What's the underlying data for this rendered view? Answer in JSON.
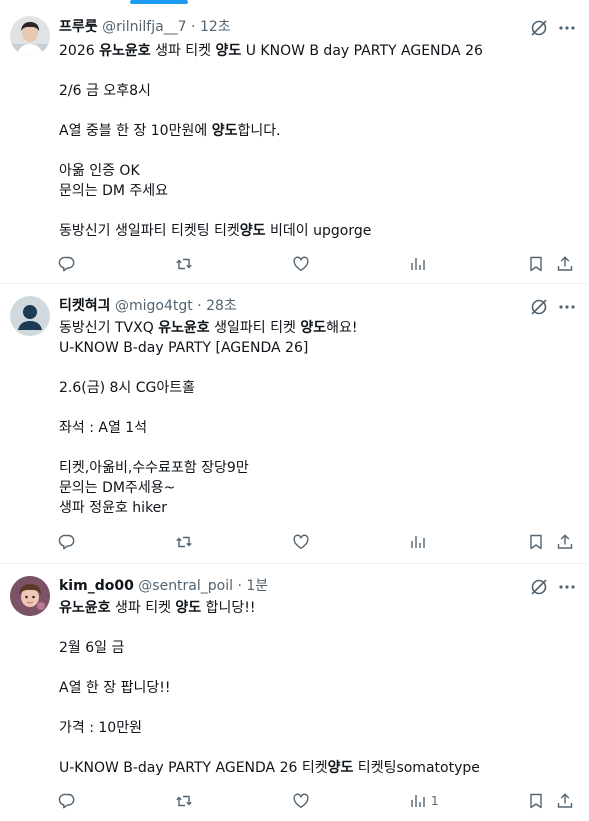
{
  "tweets": [
    {
      "name": "프루룻",
      "handle": "@rilnilfja__7",
      "time": "12초",
      "lines": [
        [
          {
            "t": "2026 "
          },
          {
            "t": "유노윤호",
            "b": true
          },
          {
            "t": " 생파 티켓 "
          },
          {
            "t": "양도",
            "b": true
          },
          {
            "t": " U KNOW B day PARTY AGENDA 26"
          }
        ],
        [],
        [
          {
            "t": "2/6 금 오후8시"
          }
        ],
        [],
        [
          {
            "t": "A열 중블 한 장 10만원에 "
          },
          {
            "t": "양도",
            "b": true
          },
          {
            "t": "합니다."
          }
        ],
        [],
        [
          {
            "t": "아옮 인증 OK"
          }
        ],
        [
          {
            "t": "문의는 DM 주세요"
          }
        ],
        [],
        [
          {
            "t": "동방신기 생일파티 티켓팅 티켓"
          },
          {
            "t": "양도",
            "b": true
          },
          {
            "t": " 비데이 upgorge"
          }
        ]
      ],
      "views": ""
    },
    {
      "name": "티켓혀긔",
      "handle": "@migo4tgt",
      "time": "28초",
      "lines": [
        [
          {
            "t": "동방신기 TVXQ "
          },
          {
            "t": "유노윤호",
            "b": true
          },
          {
            "t": " 생일파티 티켓 "
          },
          {
            "t": "양도",
            "b": true
          },
          {
            "t": "해요!"
          }
        ],
        [
          {
            "t": "U-KNOW B-day PARTY [AGENDA 26]"
          }
        ],
        [],
        [
          {
            "t": "2.6(금) 8시 CG아트홀"
          }
        ],
        [],
        [
          {
            "t": "좌석 : A열 1석"
          }
        ],
        [],
        [
          {
            "t": "티켓,아옮비,수수료포함 장당9만"
          }
        ],
        [
          {
            "t": "문의는 DM주세용~"
          }
        ],
        [
          {
            "t": "생파 정윤호 hiker"
          }
        ]
      ],
      "views": ""
    },
    {
      "name": "kim_do00",
      "handle": "@sentral_poil",
      "time": "1분",
      "lines": [
        [
          {
            "t": "유노윤호",
            "b": true
          },
          {
            "t": " 생파 티켓 "
          },
          {
            "t": "양도",
            "b": true
          },
          {
            "t": " 합니당!!"
          }
        ],
        [],
        [
          {
            "t": "2월 6일 금"
          }
        ],
        [],
        [
          {
            "t": "A열 한 장 팝니당!!"
          }
        ],
        [],
        [
          {
            "t": "가격 : 10만원"
          }
        ],
        [],
        [
          {
            "t": "U-KNOW B-day PARTY AGENDA 26 티켓"
          },
          {
            "t": "양도",
            "b": true
          },
          {
            "t": " 티켓팅somatotype"
          }
        ]
      ],
      "views": "1"
    }
  ],
  "separator": " · ",
  "icons": [
    "grok-icon",
    "more-icon",
    "reply-icon",
    "retweet-icon",
    "like-icon",
    "views-icon",
    "bookmark-icon",
    "share-icon"
  ],
  "colors": {
    "text": "#0f1419",
    "muted": "#536471",
    "accent": "#1d9bf0",
    "border": "#eff3f4"
  }
}
